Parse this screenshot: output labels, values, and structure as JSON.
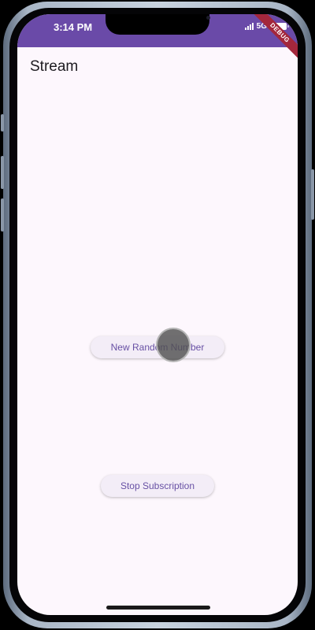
{
  "status_bar": {
    "time": "3:14 PM",
    "network": "5G",
    "color": "#6a4aa8"
  },
  "app_bar": {
    "title": "Stream"
  },
  "debug_banner": {
    "label": "DEBUG",
    "color": "#a3273c"
  },
  "buttons": {
    "new_random_number": "New Random Number",
    "stop_subscription": "Stop Subscription"
  },
  "colors": {
    "background": "#fdf7fd",
    "button_background": "#f3edf7",
    "button_text": "#6750a4"
  }
}
